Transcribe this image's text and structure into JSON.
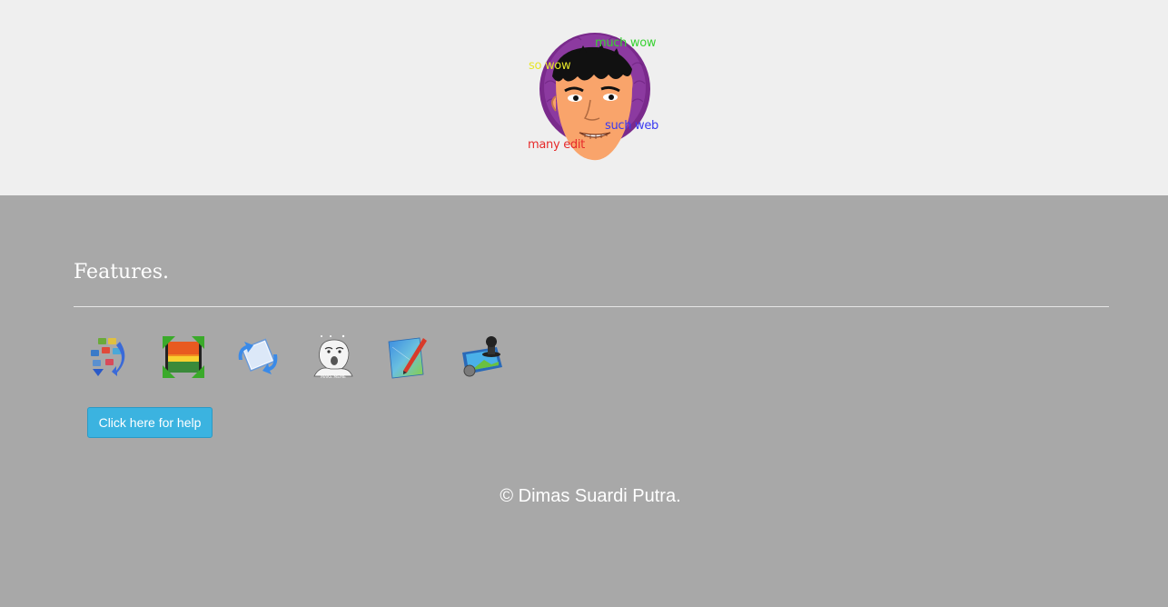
{
  "header": {
    "logo_texts": {
      "much_wow": "much wow",
      "so_wow": "so wow",
      "such_web": "such web",
      "many_edit": "many edit"
    }
  },
  "features": {
    "title": "Features.",
    "icons": [
      "image-convert-icon",
      "image-resize-icon",
      "image-rotate-icon",
      "meme-maker-icon",
      "image-edit-icon",
      "watermark-stamp-icon"
    ],
    "icon_captions": {
      "meme": "MAKE MEME"
    },
    "help_button_label": "Click here for help"
  },
  "footer": {
    "copyright": "© Dimas Suardi Putra."
  },
  "colors": {
    "header_bg": "#efefef",
    "main_bg": "#a8a8a8",
    "button_bg": "#3bb3e0",
    "much_wow": "#39d233",
    "so_wow": "#e6e62a",
    "such_web": "#3a3af0",
    "many_edit": "#e62a2a"
  }
}
